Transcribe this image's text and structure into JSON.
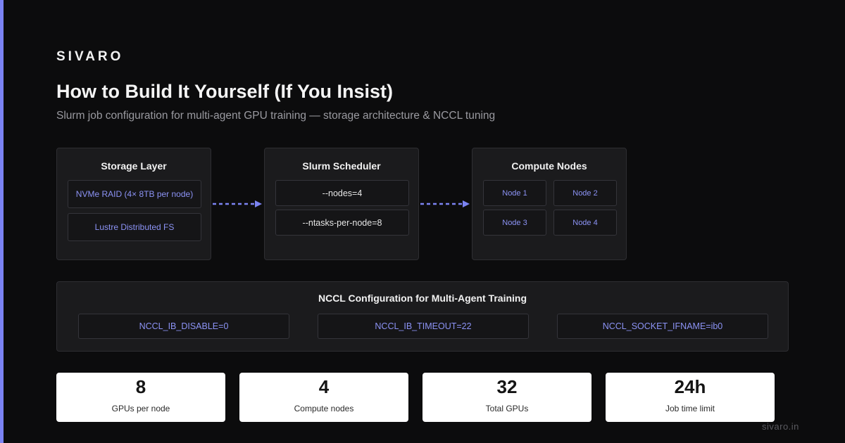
{
  "brand": "SIVARO",
  "title": "How to Build It Yourself (If You Insist)",
  "subtitle": "Slurm job configuration for multi-agent GPU training — storage architecture & NCCL tuning",
  "storage": {
    "title": "Storage Layer",
    "items": [
      "NVMe RAID (4× 8TB per node)",
      "Lustre Distributed FS"
    ]
  },
  "scheduler": {
    "title": "Slurm Scheduler",
    "items": [
      "--nodes=4",
      "--ntasks-per-node=8"
    ]
  },
  "compute": {
    "title": "Compute Nodes",
    "nodes": [
      "Node 1",
      "Node 2",
      "Node 3",
      "Node 4"
    ]
  },
  "nccl": {
    "title": "NCCL Configuration for Multi-Agent Training",
    "vars": [
      "NCCL_IB_DISABLE=0",
      "NCCL_IB_TIMEOUT=22",
      "NCCL_SOCKET_IFNAME=ib0"
    ]
  },
  "stats": [
    {
      "value": "8",
      "label": "GPUs per node"
    },
    {
      "value": "4",
      "label": "Compute nodes"
    },
    {
      "value": "32",
      "label": "Total GPUs"
    },
    {
      "value": "24h",
      "label": "Job time limit"
    }
  ],
  "footer": "sivaro.in",
  "colors": {
    "accent": "#7b83f2",
    "background": "#0c0c0d",
    "panel": "#1b1b1d"
  }
}
